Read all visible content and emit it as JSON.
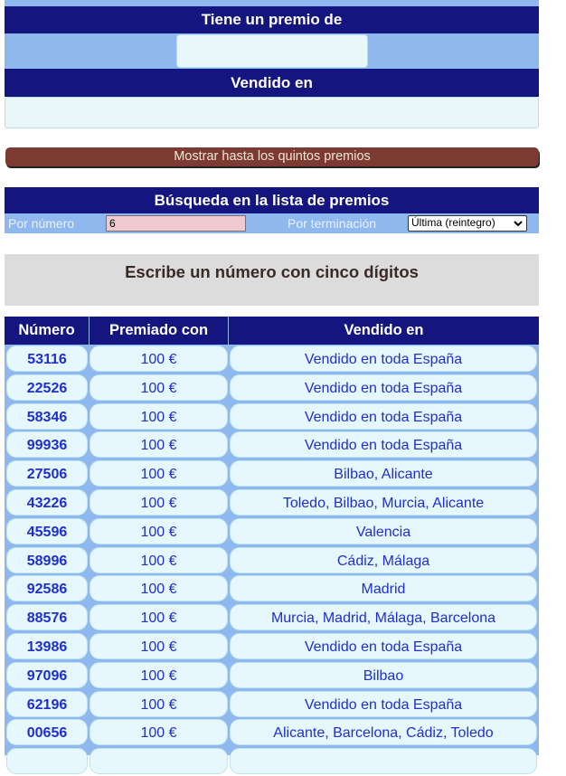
{
  "prize_section": {
    "premio_header": "Tiene un premio de",
    "premio_value": "",
    "vendido_header": "Vendido en",
    "vendido_value": ""
  },
  "show_button_label": "Mostrar hasta los quintos premios",
  "search": {
    "title": "Búsqueda en la lista de premios",
    "by_number_label": "Por número",
    "number_value": "6",
    "by_ending_label": "Por terminación",
    "ending_selected": "Última (reintegro)"
  },
  "message": "Escribe un número con cinco dígitos",
  "table": {
    "headers": [
      "Número",
      "Premiado con",
      "Vendido en"
    ],
    "rows": [
      {
        "numero": "53116",
        "premio": "100 €",
        "vendido": "Vendido en toda España"
      },
      {
        "numero": "22526",
        "premio": "100 €",
        "vendido": "Vendido en toda España"
      },
      {
        "numero": "58346",
        "premio": "100 €",
        "vendido": "Vendido en toda España"
      },
      {
        "numero": "99936",
        "premio": "100 €",
        "vendido": "Vendido en toda España"
      },
      {
        "numero": "27506",
        "premio": "100 €",
        "vendido": "Bilbao, Alicante"
      },
      {
        "numero": "43226",
        "premio": "100 €",
        "vendido": "Toledo, Bilbao, Murcia, Alicante"
      },
      {
        "numero": "45596",
        "premio": "100 €",
        "vendido": "Valencia"
      },
      {
        "numero": "58996",
        "premio": "100 €",
        "vendido": "Cádiz, Málaga"
      },
      {
        "numero": "92586",
        "premio": "100 €",
        "vendido": "Madrid"
      },
      {
        "numero": "88576",
        "premio": "100 €",
        "vendido": "Murcia, Madrid, Málaga, Barcelona"
      },
      {
        "numero": "13986",
        "premio": "100 €",
        "vendido": "Vendido en toda España"
      },
      {
        "numero": "97096",
        "premio": "100 €",
        "vendido": "Bilbao"
      },
      {
        "numero": "62196",
        "premio": "100 €",
        "vendido": "Vendido en toda España"
      },
      {
        "numero": "00656",
        "premio": "100 €",
        "vendido": "Alicante, Barcelona, Cádiz, Toledo"
      }
    ]
  },
  "colors": {
    "navy": "#14157f",
    "light_blue": "#8fb8ee",
    "button_brown": "#7d3a33",
    "cell_bg": "#e6f8fd",
    "cell_text": "#1f2ed0"
  }
}
